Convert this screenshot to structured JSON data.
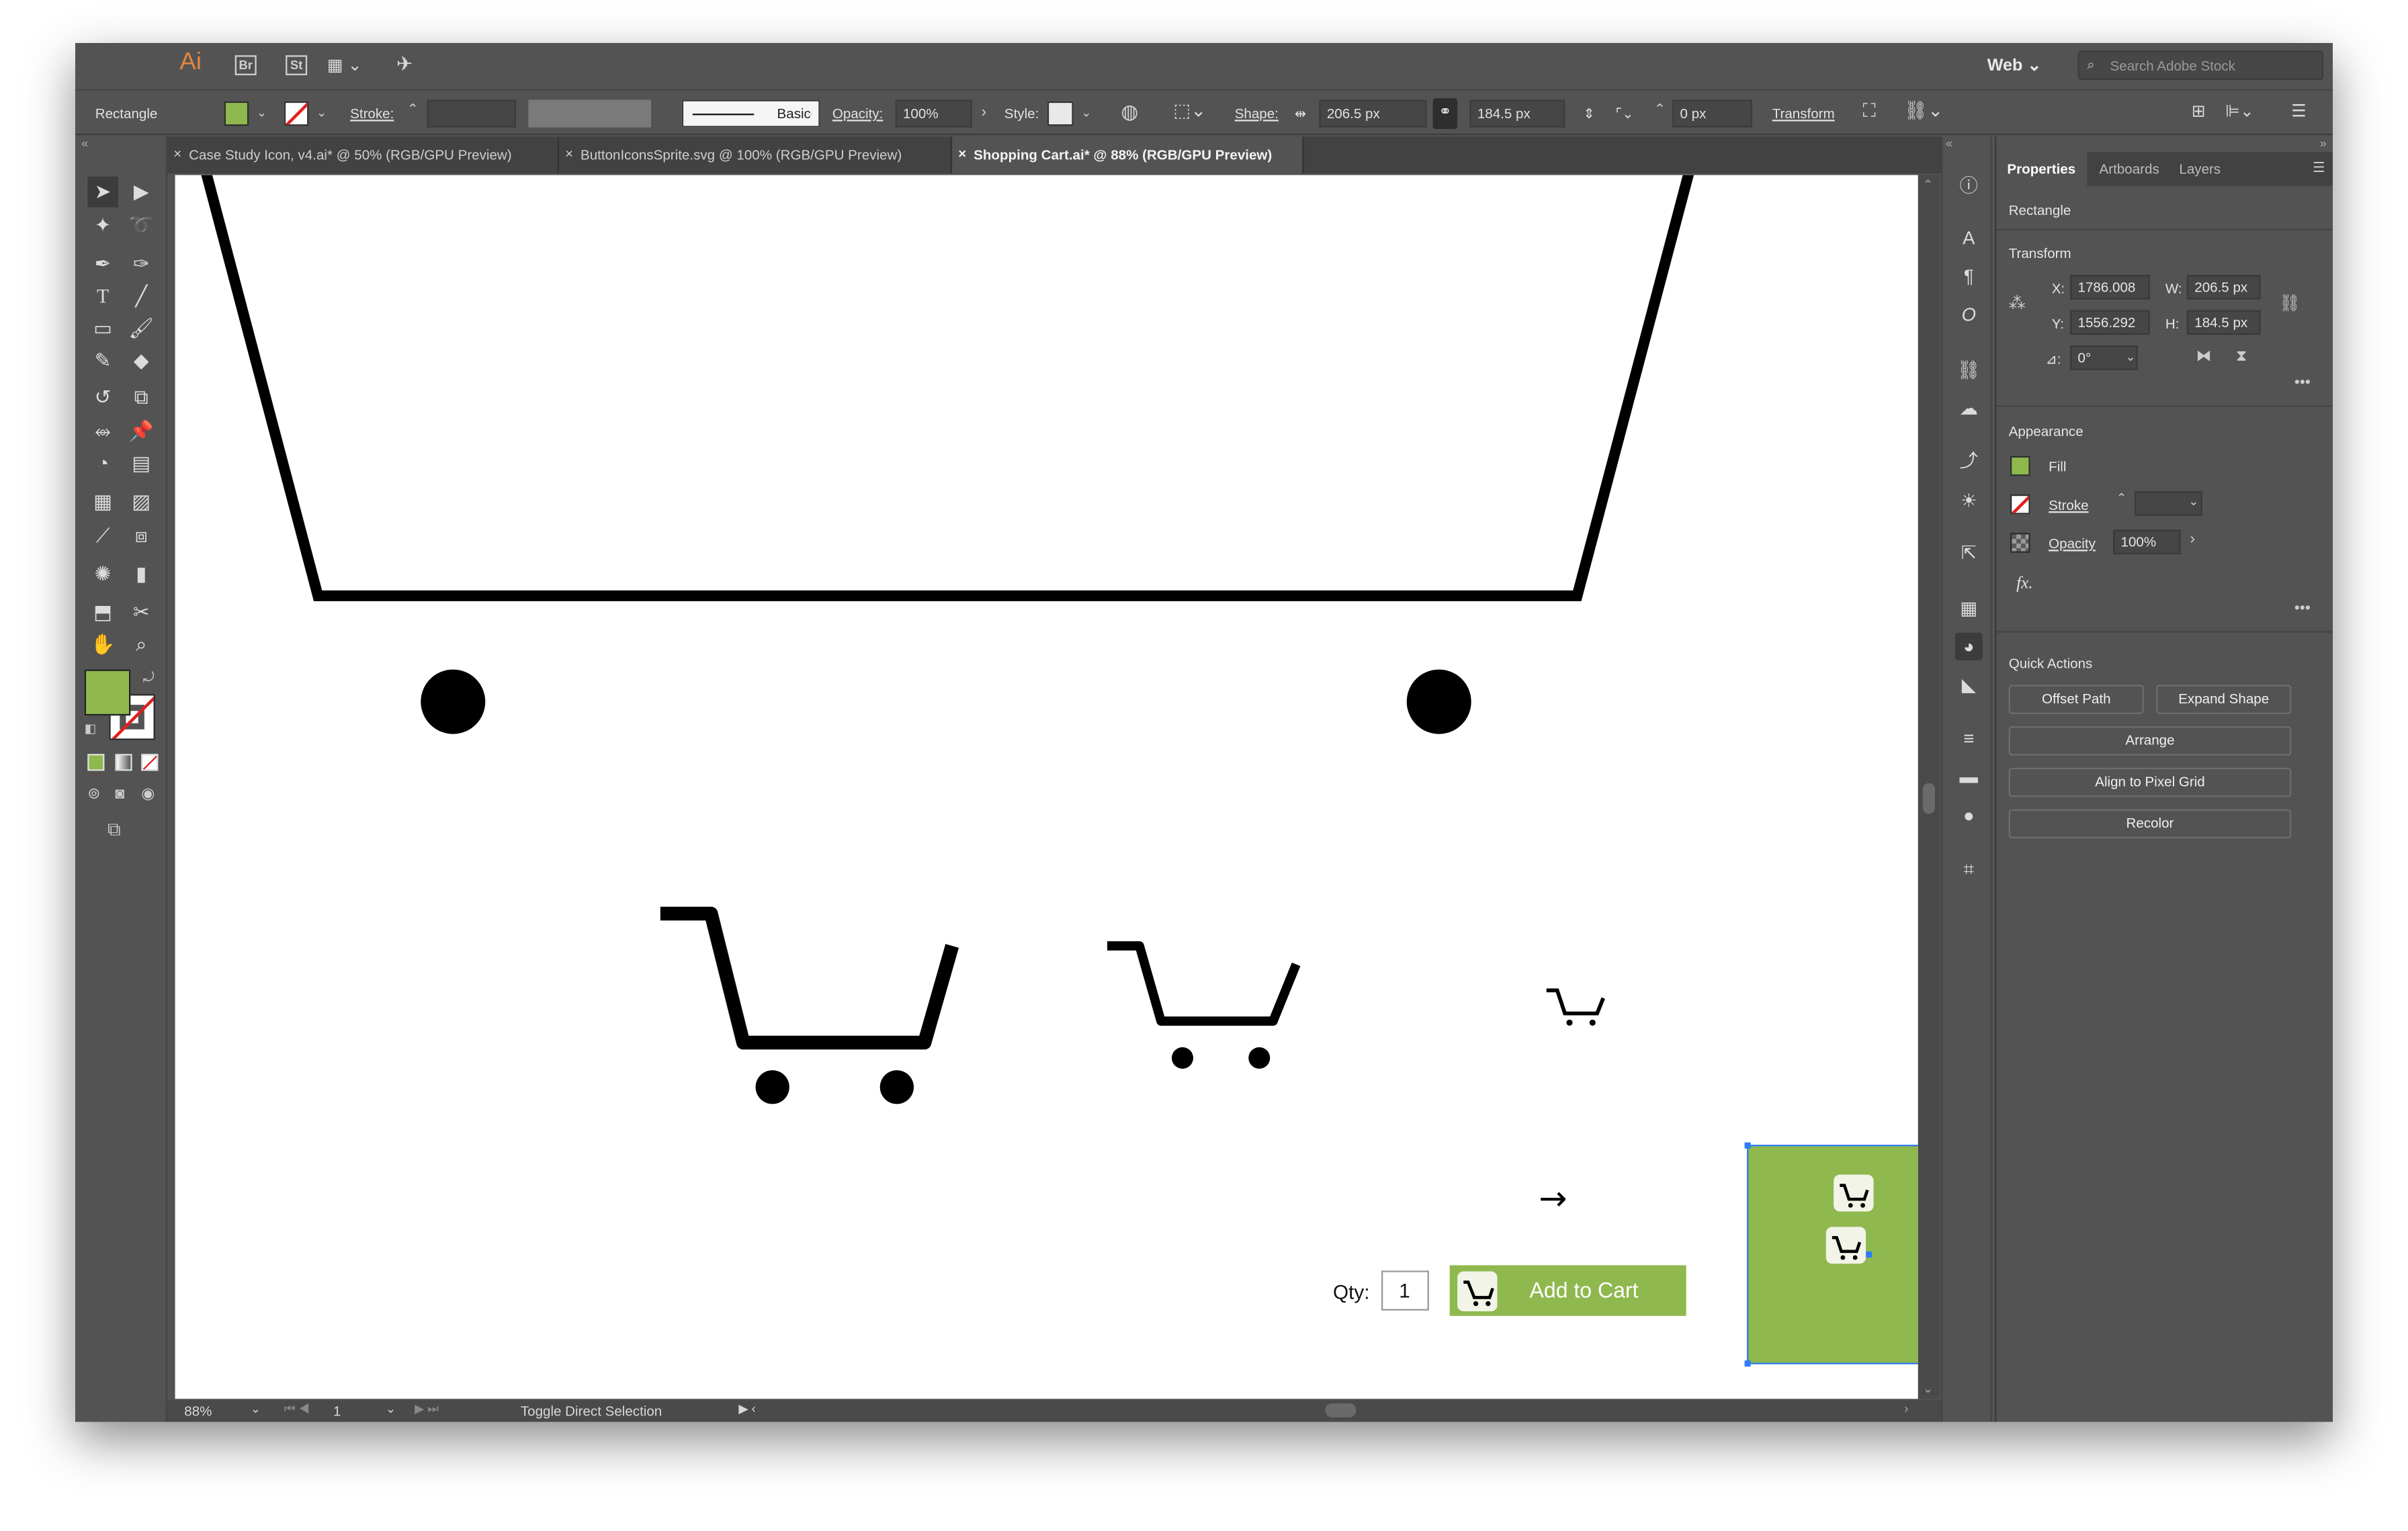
{
  "app": {
    "logo": "Ai",
    "bridge": "Br",
    "stock": "St",
    "workspace": "Web",
    "search_placeholder": "Search Adobe Stock"
  },
  "control_bar": {
    "selection_type": "Rectangle",
    "stroke_label": "Stroke:",
    "brush_label": "Basic",
    "opacity_label": "Opacity:",
    "opacity_value": "100%",
    "style_label": "Style:",
    "shape_label": "Shape:",
    "width_value": "206.5 px",
    "height_value": "184.5 px",
    "corner_value": "0 px",
    "transform_label": "Transform",
    "fill_color": "#8fb84e"
  },
  "tabs": [
    {
      "label": "Case Study Icon, v4.ai* @ 50% (RGB/GPU Preview)",
      "active": false
    },
    {
      "label": "ButtonIconsSprite.svg @ 100% (RGB/GPU Preview)",
      "active": false
    },
    {
      "label": "Shopping Cart.ai* @ 88% (RGB/GPU Preview)",
      "active": true
    }
  ],
  "status_bar": {
    "zoom": "88%",
    "artboard": "1",
    "status_text": "Toggle Direct Selection"
  },
  "canvas": {
    "qty_label": "Qty:",
    "qty_value": "1",
    "add_to_cart_label": "Add to Cart",
    "button_color": "#8fb84e",
    "arrow_glyph": "→"
  },
  "panel": {
    "tabs": [
      "Properties",
      "Artboards",
      "Layers"
    ],
    "object_type": "Rectangle",
    "transform": {
      "title": "Transform",
      "x_label": "X:",
      "x_value": "1786.008",
      "y_label": "Y:",
      "y_value": "1556.292",
      "w_label": "W:",
      "w_value": "206.5 px",
      "h_label": "H:",
      "h_value": "184.5 px",
      "angle_label": "⊿:",
      "angle_value": "0°"
    },
    "appearance": {
      "title": "Appearance",
      "fill_label": "Fill",
      "stroke_label": "Stroke",
      "opacity_label": "Opacity",
      "opacity_value": "100%",
      "fx_label": "fx."
    },
    "quick_actions": {
      "title": "Quick Actions",
      "offset_path": "Offset Path",
      "expand_shape": "Expand Shape",
      "arrange": "Arrange",
      "align_pixel_grid": "Align to Pixel Grid",
      "recolor": "Recolor"
    }
  }
}
